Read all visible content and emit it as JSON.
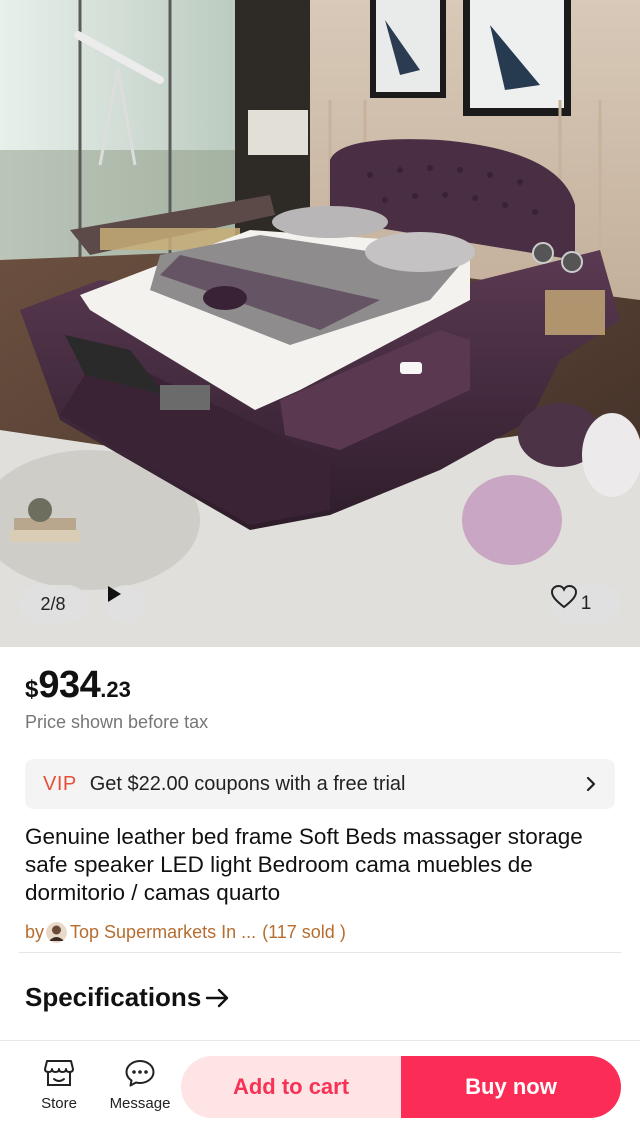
{
  "gallery": {
    "counter": "2/8",
    "favorite_count": "1",
    "icons": {
      "play": "play-icon",
      "favorite": "heart-icon"
    }
  },
  "price": {
    "currency": "$",
    "integer": "934",
    "decimal": ".23",
    "note": "Price shown before tax"
  },
  "vip": {
    "tag": "VIP",
    "text": "Get $22.00 coupons with a free trial",
    "chevron": "›"
  },
  "product": {
    "title": "Genuine leather bed frame Soft Beds massager storage safe speaker LED light Bedroom cama muebles de dormitorio / camas quarto"
  },
  "seller": {
    "by": "by",
    "name": "Top Supermarkets In ...",
    "sold": "(117 sold )"
  },
  "specifications": {
    "label": "Specifications",
    "arrow": "→"
  },
  "bottom_bar": {
    "store": "Store",
    "message": "Message",
    "add_to_cart": "Add to cart",
    "buy_now": "Buy now"
  },
  "colors": {
    "accent": "#fb2c55",
    "cart_bg": "#ffe4e6",
    "vip": "#e6503a",
    "seller": "#b66d2f"
  }
}
